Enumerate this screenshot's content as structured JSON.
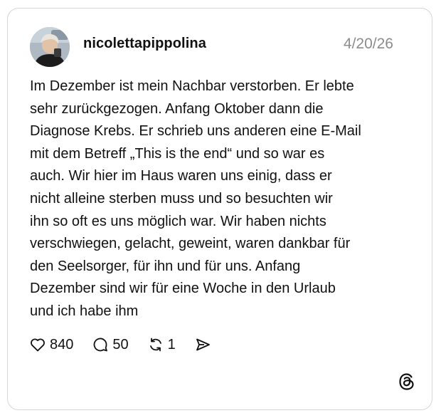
{
  "post": {
    "username": "nicolettapippolina",
    "date": "4/20/26",
    "lines": [
      "Im Dezember ist mein Nachbar verstorben. Er lebte",
      "sehr zurückgezogen. Anfang Oktober dann die",
      "Diagnose Krebs. Er schrieb uns anderen eine E-Mail",
      "mit dem Betreff „This is the end“ und so war es",
      "auch. Wir hier im Haus waren uns einig, dass er",
      "nicht alleine sterben muss und so besuchten wir",
      "ihn so oft es uns möglich war. Wir haben nichts",
      "verschwiegen, gelacht, geweint, waren dankbar für",
      "den Seelsorger, für ihn und für uns. Anfang",
      "Dezember sind wir für eine Woche in den Urlaub",
      "und ich habe ihm"
    ]
  },
  "actions": {
    "likes": "840",
    "replies": "50",
    "reposts": "1"
  },
  "icons": {
    "like": "heart-icon",
    "reply": "comment-bubble-icon",
    "repost": "repost-arrows-icon",
    "share": "send-icon",
    "brand": "threads-logo-icon"
  },
  "colors": {
    "text": "#111111",
    "muted": "#8c8c8c",
    "border": "#d6d6d6"
  }
}
